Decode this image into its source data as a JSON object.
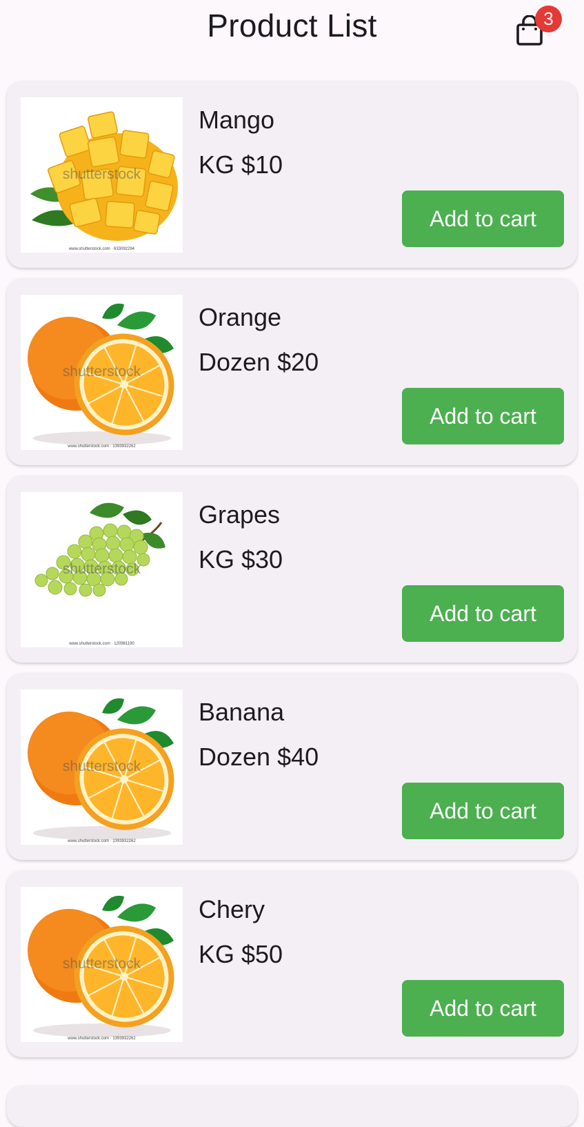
{
  "header": {
    "title": "Product List",
    "cart_count": "3",
    "cart_icon": "shopping-bag-icon"
  },
  "products": [
    {
      "name": "Mango",
      "price": "KG $10",
      "button": "Add to cart",
      "image": "mango",
      "watermark": "shutterstock",
      "watermark_url": "www.shutterstock.com · 633092294"
    },
    {
      "name": "Orange",
      "price": "Dozen $20",
      "button": "Add to cart",
      "image": "orange",
      "watermark": "shutterstock",
      "watermark_url": "www.shutterstock.com · 1393932262"
    },
    {
      "name": "Grapes",
      "price": "KG $30",
      "button": "Add to cart",
      "image": "grapes",
      "watermark": "shutterstock",
      "watermark_url": "www.shutterstock.com · 120981190"
    },
    {
      "name": "Banana",
      "price": "Dozen $40",
      "button": "Add to cart",
      "image": "orange",
      "watermark": "shutterstock",
      "watermark_url": "www.shutterstock.com · 1393932262"
    },
    {
      "name": "Chery",
      "price": "KG $50",
      "button": "Add to cart",
      "image": "orange",
      "watermark": "shutterstock",
      "watermark_url": "www.shutterstock.com · 1393932262"
    }
  ],
  "colors": {
    "button": "#4caf50",
    "badge": "#e53935",
    "card": "#f3eff5",
    "background": "#fdf8fb"
  }
}
